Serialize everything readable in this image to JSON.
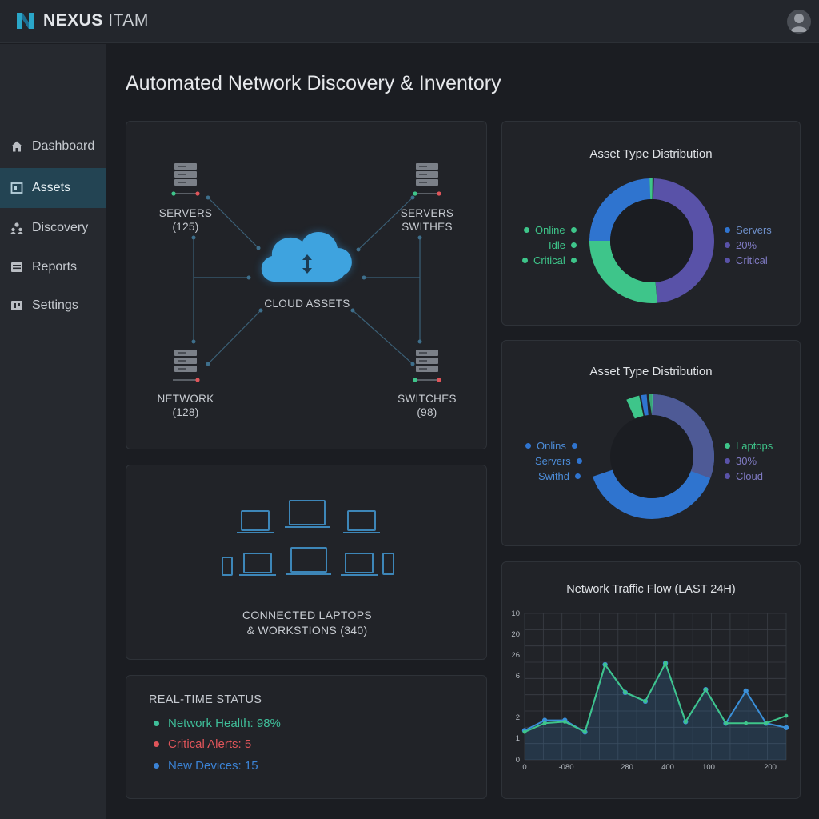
{
  "app": {
    "name_bold": "NEXUS",
    "name_light": "ITAM"
  },
  "sidebar": {
    "items": [
      {
        "label": "Dashboard",
        "icon": "home-icon"
      },
      {
        "label": "Assets",
        "icon": "assets-icon",
        "active": true
      },
      {
        "label": "Discovery",
        "icon": "users-icon"
      },
      {
        "label": "Reports",
        "icon": "reports-icon"
      },
      {
        "label": "Settings",
        "icon": "settings-icon"
      }
    ]
  },
  "page": {
    "title": "Automated Network Discovery & Inventory"
  },
  "topology": {
    "center": {
      "label": "CLOUD ASSETS"
    },
    "nodes": [
      {
        "label": "SERVERS",
        "count": "(125)"
      },
      {
        "label": "SERVERS",
        "count": "SWITHES"
      },
      {
        "label": "NETWORK",
        "count": "(128)"
      },
      {
        "label": "SWITCHES",
        "count": "(98)"
      }
    ]
  },
  "devices": {
    "label_line1": "CONNECTED LAPTOPS",
    "label_line2": "& WORKSTIONS (340)"
  },
  "status": {
    "title": "REAL-TIME STATUS",
    "rows": [
      {
        "text": "Network Health: 98%",
        "color": "#3fbf9a"
      },
      {
        "text": "Critical Alerts: 5",
        "color": "#e0555a"
      },
      {
        "text": "New Devices: 15",
        "color": "#3b83d6"
      }
    ]
  },
  "donut1": {
    "title": "Asset Type Distribution",
    "left_legend": [
      "Online",
      "Idle",
      "Critical"
    ],
    "right_legend": [
      "Servers",
      "20%",
      "Critical"
    ],
    "colors": {
      "blue": "#2f74cf",
      "green": "#3ec58a",
      "purple": "#5952a8"
    }
  },
  "donut2": {
    "title": "Asset Type Distribution",
    "left_legend": [
      "Onlins",
      "Servers",
      "Swithd"
    ],
    "right_legend": [
      "Laptops",
      "30%",
      "Cloud"
    ]
  },
  "traffic": {
    "title": "Network Traffic Flow (LAST 24H)",
    "y_ticks": [
      "10",
      "20",
      "26",
      "6",
      "2",
      "1",
      "0"
    ],
    "x_ticks": [
      "0",
      "-080",
      "280",
      "400",
      "100",
      "200"
    ]
  },
  "chart_data": {
    "type": "line",
    "title": "Network Traffic Flow (LAST 24H)",
    "x_tick_labels": [
      "0",
      "-080",
      "280",
      "400",
      "100",
      "200"
    ],
    "series": [
      {
        "color": "#3a8fd8",
        "values": [
          2.0,
          2.7,
          2.7,
          1.9,
          6.5,
          4.6,
          4.0,
          6.6,
          2.6,
          4.8,
          2.5,
          4.7,
          2.5,
          2.2
        ]
      },
      {
        "color": "#3ec58a",
        "values": [
          1.9,
          2.5,
          2.6,
          1.9,
          6.5,
          4.6,
          4.0,
          6.6,
          2.6,
          4.8,
          2.5,
          2.5,
          2.5,
          3.0
        ]
      }
    ]
  }
}
